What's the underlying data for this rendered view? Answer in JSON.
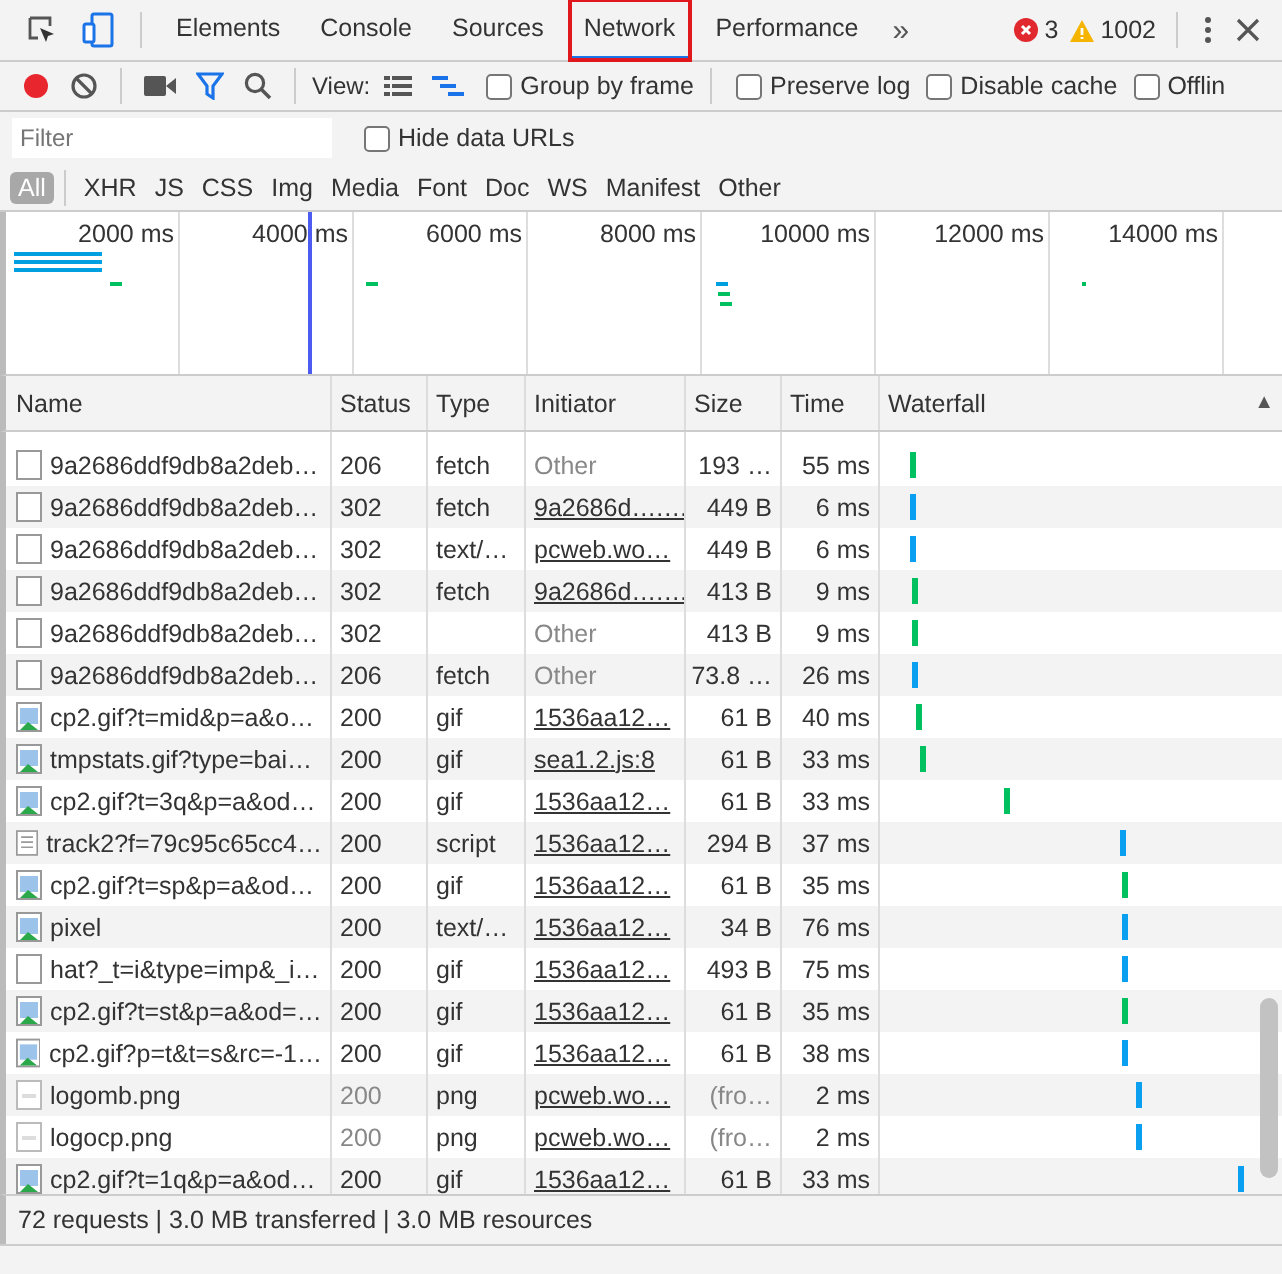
{
  "tabs": [
    {
      "label": "Elements",
      "selected": false,
      "annotated": false
    },
    {
      "label": "Console",
      "selected": false,
      "annotated": false
    },
    {
      "label": "Sources",
      "selected": false,
      "annotated": false
    },
    {
      "label": "Network",
      "selected": true,
      "annotated": true
    },
    {
      "label": "Performance",
      "selected": false,
      "annotated": false
    }
  ],
  "more_tabs": "»",
  "errors": "3",
  "warnings": "1002",
  "toolbar": {
    "recording": true,
    "filter_active": true,
    "view_label": "View:",
    "large_rows": false,
    "waterfall_view": true,
    "options": [
      {
        "label": "Group by frame",
        "checked": false
      },
      {
        "label": "Preserve log",
        "checked": false
      },
      {
        "label": "Disable cache",
        "checked": false
      },
      {
        "label": "Offlin",
        "checked": false
      }
    ]
  },
  "filter": {
    "placeholder": "Filter",
    "hide_data_urls": {
      "label": "Hide data URLs",
      "checked": false
    }
  },
  "types": [
    {
      "label": "All",
      "selected": true
    },
    {
      "label": "XHR",
      "selected": false
    },
    {
      "label": "JS",
      "selected": false
    },
    {
      "label": "CSS",
      "selected": false
    },
    {
      "label": "Img",
      "selected": false
    },
    {
      "label": "Media",
      "selected": false
    },
    {
      "label": "Font",
      "selected": false
    },
    {
      "label": "Doc",
      "selected": false
    },
    {
      "label": "WS",
      "selected": false
    },
    {
      "label": "Manifest",
      "selected": false
    },
    {
      "label": "Other",
      "selected": false
    }
  ],
  "overview": {
    "ticks": [
      "2000 ms",
      "4000 ms",
      "6000 ms",
      "8000 ms",
      "10000 ms",
      "12000 ms",
      "14000 ms"
    ]
  },
  "table": {
    "columns": [
      "Name",
      "Status",
      "Type",
      "Initiator",
      "Size",
      "Time",
      "Waterfall"
    ],
    "sort_indicator": "▲",
    "rows": [
      {
        "kind": "blank",
        "name": "9a2686ddf9db8a2deb…",
        "status": "206",
        "type": "fetch",
        "initiator": "Other",
        "initiator_link": false,
        "size": "193 …",
        "time": "55 ms",
        "cached": false
      },
      {
        "kind": "blank",
        "name": "9a2686ddf9db8a2deb…",
        "status": "302",
        "type": "fetch",
        "initiator": "9a2686d….…",
        "initiator_link": true,
        "size": "449 B",
        "time": "6 ms",
        "cached": false
      },
      {
        "kind": "blank",
        "name": "9a2686ddf9db8a2deb…",
        "status": "302",
        "type": "text/…",
        "initiator": "pcweb.wo…",
        "initiator_link": true,
        "size": "449 B",
        "time": "6 ms",
        "cached": false
      },
      {
        "kind": "blank",
        "name": "9a2686ddf9db8a2deb…",
        "status": "302",
        "type": "fetch",
        "initiator": "9a2686d….…",
        "initiator_link": true,
        "size": "413 B",
        "time": "9 ms",
        "cached": false
      },
      {
        "kind": "blank",
        "name": "9a2686ddf9db8a2deb…",
        "status": "302",
        "initiator": "Other",
        "initiator_link": false,
        "size": "413 B",
        "time": "9 ms",
        "cached": false
      },
      {
        "kind": "blank",
        "name": "9a2686ddf9db8a2deb…",
        "status": "206",
        "type": "fetch",
        "initiator": "Other",
        "initiator_link": false,
        "size": "73.8 …",
        "time": "26 ms",
        "cached": false
      },
      {
        "kind": "image",
        "name": "cp2.gif?t=mid&p=a&o…",
        "status": "200",
        "type": "gif",
        "initiator": "1536aa12…",
        "initiator_link": true,
        "size": "61 B",
        "time": "40 ms",
        "cached": false
      },
      {
        "kind": "image",
        "name": "tmpstats.gif?type=bai…",
        "status": "200",
        "type": "gif",
        "initiator": "sea1.2.js:8",
        "initiator_link": true,
        "size": "61 B",
        "time": "33 ms",
        "cached": false
      },
      {
        "kind": "image",
        "name": "cp2.gif?t=3q&p=a&od…",
        "status": "200",
        "type": "gif",
        "initiator": "1536aa12…",
        "initiator_link": true,
        "size": "61 B",
        "time": "33 ms",
        "cached": false
      },
      {
        "kind": "text",
        "name": "track2?f=79c95c65cc4…",
        "status": "200",
        "type": "script",
        "initiator": "1536aa12…",
        "initiator_link": true,
        "size": "294 B",
        "time": "37 ms",
        "cached": false
      },
      {
        "kind": "image",
        "name": "cp2.gif?t=sp&p=a&od…",
        "status": "200",
        "type": "gif",
        "initiator": "1536aa12…",
        "initiator_link": true,
        "size": "61 B",
        "time": "35 ms",
        "cached": false
      },
      {
        "kind": "image",
        "name": "pixel",
        "status": "200",
        "type": "text/…",
        "initiator": "1536aa12…",
        "initiator_link": true,
        "size": "34 B",
        "time": "76 ms",
        "cached": false
      },
      {
        "kind": "blank",
        "name": "hat?_t=i&type=imp&_i…",
        "status": "200",
        "type": "gif",
        "initiator": "1536aa12…",
        "initiator_link": true,
        "size": "493 B",
        "time": "75 ms",
        "cached": false
      },
      {
        "kind": "image",
        "name": "cp2.gif?t=st&p=a&od=…",
        "status": "200",
        "type": "gif",
        "initiator": "1536aa12…",
        "initiator_link": true,
        "size": "61 B",
        "time": "35 ms",
        "cached": false
      },
      {
        "kind": "image",
        "name": "cp2.gif?p=t&t=s&rc=-1…",
        "status": "200",
        "type": "gif",
        "initiator": "1536aa12…",
        "initiator_link": true,
        "size": "61 B",
        "time": "38 ms",
        "cached": false
      },
      {
        "kind": "cached",
        "name": "logomb.png",
        "status": "200",
        "type": "png",
        "initiator": "pcweb.wo…",
        "initiator_link": true,
        "size": "(fro…",
        "time": "2 ms",
        "cached": true
      },
      {
        "kind": "cached",
        "name": "logocp.png",
        "status": "200",
        "type": "png",
        "initiator": "pcweb.wo…",
        "initiator_link": true,
        "size": "(fro…",
        "time": "2 ms",
        "cached": true
      },
      {
        "kind": "image",
        "name": "cp2.gif?t=1q&p=a&od…",
        "status": "200",
        "type": "gif",
        "initiator": "1536aa12…",
        "initiator_link": true,
        "size": "61 B",
        "time": "33 ms",
        "cached": false
      }
    ]
  },
  "status_bar": "72 requests | 3.0 MB transferred | 3.0 MB resources"
}
